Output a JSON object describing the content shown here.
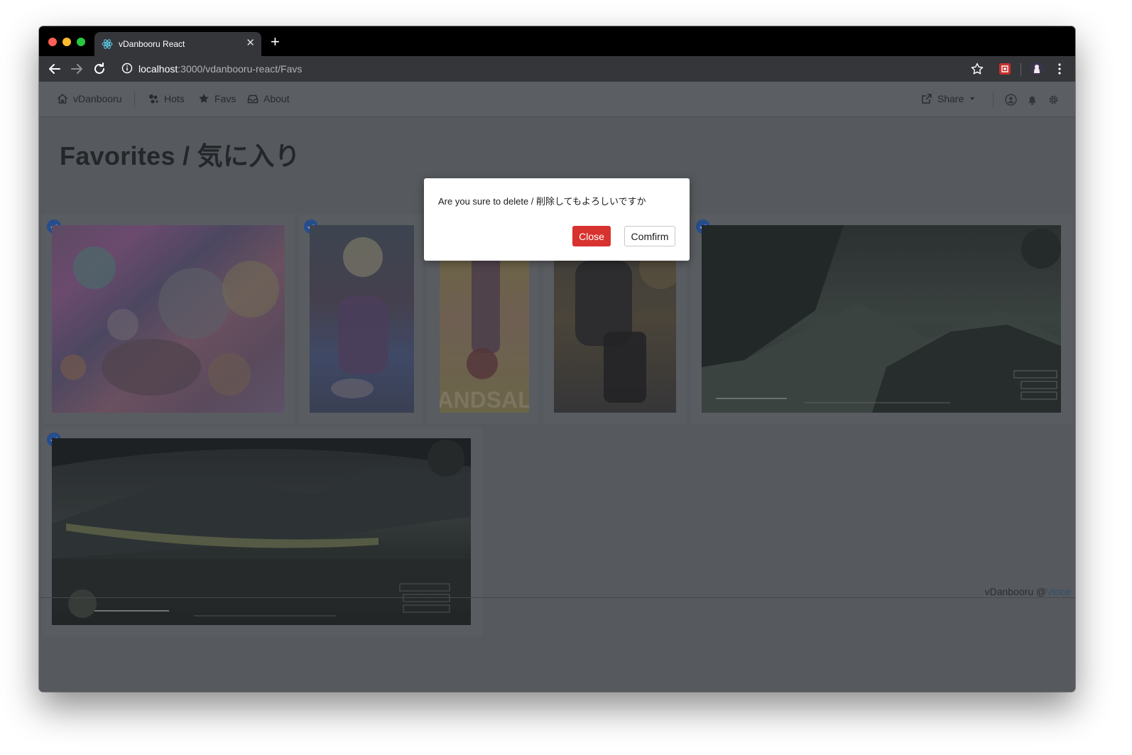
{
  "browser": {
    "tab_title": "vDanbooru React",
    "new_tab_label": "+",
    "tab_close_label": "✕",
    "url_host": "localhost",
    "url_rest": ":3000/vdanbooru-react/Favs"
  },
  "navbar": {
    "brand": "vDanbooru",
    "items": [
      {
        "label": "Hots",
        "icon": "hots-icon"
      },
      {
        "label": "Favs",
        "icon": "star-icon"
      },
      {
        "label": "About",
        "icon": "inbox-icon"
      }
    ],
    "share_label": "Share",
    "right_icons": [
      "user-circle-icon",
      "bell-icon",
      "gear-icon"
    ]
  },
  "page": {
    "title": "Favorites / 気に入り"
  },
  "gallery": {
    "items": [
      {
        "name": "halloween-party",
        "selected": true
      },
      {
        "name": "yukata-fireworks",
        "selected": true
      },
      {
        "name": "upside-down-girl",
        "selected": false,
        "caption": "ANDSAL"
      },
      {
        "name": "dark-outfit-girl",
        "selected": false
      },
      {
        "name": "rocky-plateau",
        "selected": true
      },
      {
        "name": "ruined-stadium",
        "selected": true
      }
    ]
  },
  "footer": {
    "text": "vDanbooru @",
    "link": "Vince"
  },
  "modal": {
    "message": "Are you sure to delete / 削除してもよろしいですか",
    "close_label": "Close",
    "confirm_label": "Comfirm"
  },
  "colors": {
    "danger": "#d8322f",
    "check": "#264d8c",
    "overlay_bg": "#56595d"
  }
}
